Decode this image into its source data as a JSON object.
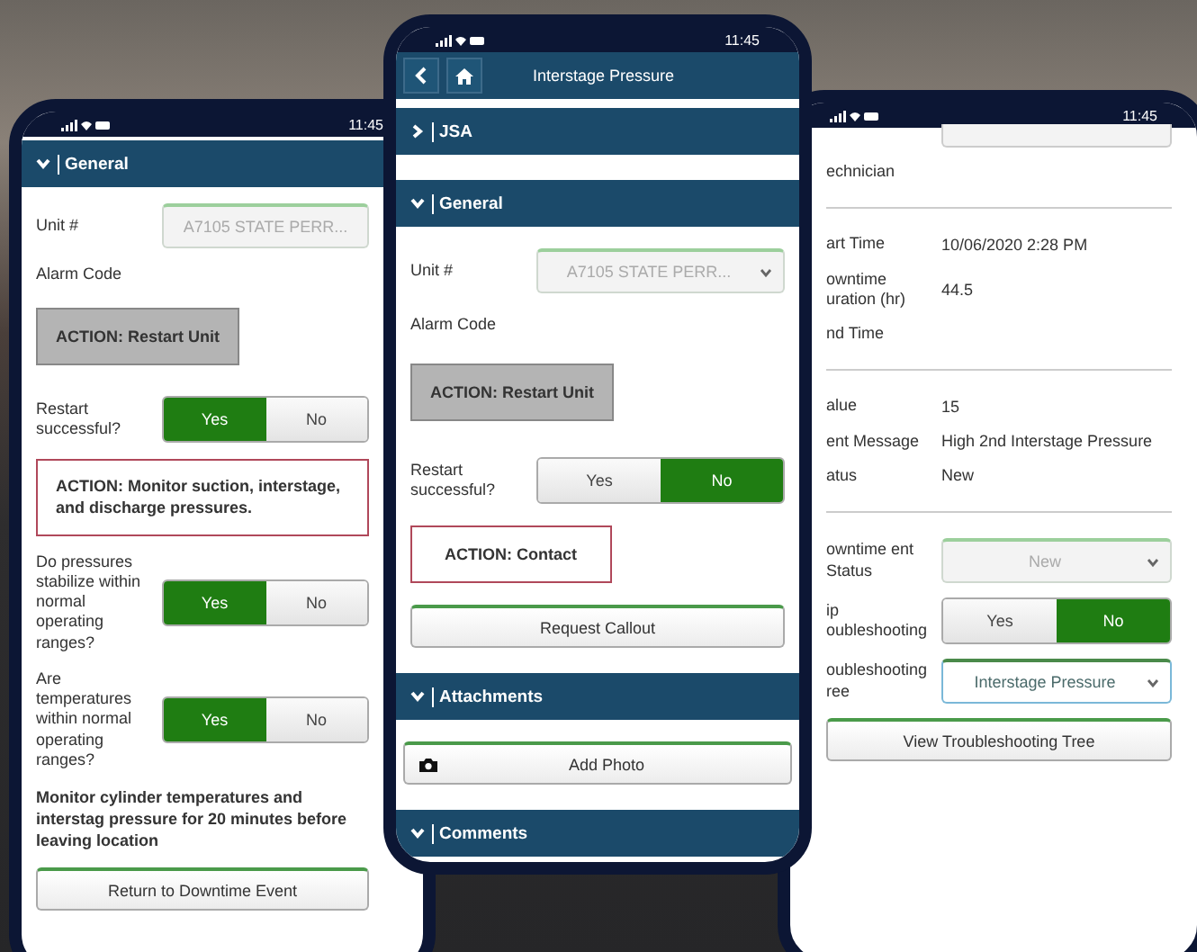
{
  "phones": [
    {
      "status_bar": {
        "time": "11:45"
      },
      "items": [
        {
          "kind": "header",
          "label": "General",
          "expanded": true
        },
        {
          "kind": "select",
          "label": "Unit #",
          "value": "A7105 STATE PERR...",
          "caret": false,
          "disabled": true
        },
        {
          "kind": "label",
          "label": "Alarm Code"
        },
        {
          "kind": "action_button",
          "label": "ACTION: Restart Unit"
        },
        {
          "kind": "toggle",
          "label": "Restart successful?",
          "options": [
            {
              "label": "Yes",
              "selected": true
            },
            {
              "label": "No",
              "selected": false
            }
          ]
        },
        {
          "kind": "action_note",
          "label": "ACTION: Monitor suction, interstage, and discharge pressures."
        },
        {
          "kind": "toggle",
          "label": "Do pressures stabilize within normal operating ranges?",
          "options": [
            {
              "label": "Yes",
              "selected": true
            },
            {
              "label": "No",
              "selected": false
            }
          ]
        },
        {
          "kind": "toggle",
          "label": "Are temperatures within normal operating ranges?",
          "options": [
            {
              "label": "Yes",
              "selected": true
            },
            {
              "label": "No",
              "selected": false
            }
          ]
        },
        {
          "kind": "note",
          "label": "Monitor cylinder temperatures and interstag pressure for 20 minutes before leaving location"
        },
        {
          "kind": "button",
          "label": "Return to Downtime Event"
        }
      ]
    },
    {
      "status_bar": {
        "time": "11:45"
      },
      "items": [
        {
          "kind": "nav",
          "label": "Interstage Pressure"
        },
        {
          "kind": "header",
          "label": "JSA",
          "expanded": false
        },
        {
          "kind": "header",
          "label": "General",
          "expanded": true
        },
        {
          "kind": "select",
          "label": "Unit #",
          "value": "A7105 STATE PERR...",
          "caret": true,
          "disabled": true
        },
        {
          "kind": "label",
          "label": "Alarm Code"
        },
        {
          "kind": "action_button",
          "label": "ACTION: Restart Unit"
        },
        {
          "kind": "toggle",
          "label": "Restart successful?",
          "options": [
            {
              "label": "Yes",
              "selected": false
            },
            {
              "label": "No",
              "selected": true
            }
          ]
        },
        {
          "kind": "action_note",
          "label": "ACTION: Contact"
        },
        {
          "kind": "button",
          "label": "Request Callout"
        },
        {
          "kind": "header",
          "label": "Attachments",
          "expanded": true
        },
        {
          "kind": "photo_button",
          "label": "Add Photo"
        },
        {
          "kind": "header",
          "label": "Comments",
          "expanded": true
        }
      ]
    },
    {
      "status_bar": {
        "time": "11:45"
      },
      "items": [
        {
          "kind": "top_field"
        },
        {
          "kind": "label",
          "label": "echnician"
        },
        {
          "kind": "divider"
        },
        {
          "kind": "info",
          "label": "art Time",
          "value": "10/06/2020 2:28 PM"
        },
        {
          "kind": "info",
          "label": "owntime uration (hr)",
          "value": "44.5"
        },
        {
          "kind": "label",
          "label": "nd Time"
        },
        {
          "kind": "divider"
        },
        {
          "kind": "info",
          "label": "alue",
          "value": "15"
        },
        {
          "kind": "info",
          "label": "ent Message",
          "value": "High 2nd Interstage Pressure"
        },
        {
          "kind": "info",
          "label": "atus",
          "value": "New"
        },
        {
          "kind": "divider"
        },
        {
          "kind": "select",
          "label": "owntime ent Status",
          "value": "New",
          "caret": true,
          "disabled": true
        },
        {
          "kind": "toggle",
          "label": "ip oubleshooting",
          "options": [
            {
              "label": "Yes",
              "selected": false
            },
            {
              "label": "No",
              "selected": true
            }
          ]
        },
        {
          "kind": "select",
          "label": "oubleshooting ree",
          "value": "Interstage Pressure",
          "caret": true,
          "disabled": false
        },
        {
          "kind": "button",
          "label": "View Troubleshooting Tree"
        }
      ]
    }
  ]
}
